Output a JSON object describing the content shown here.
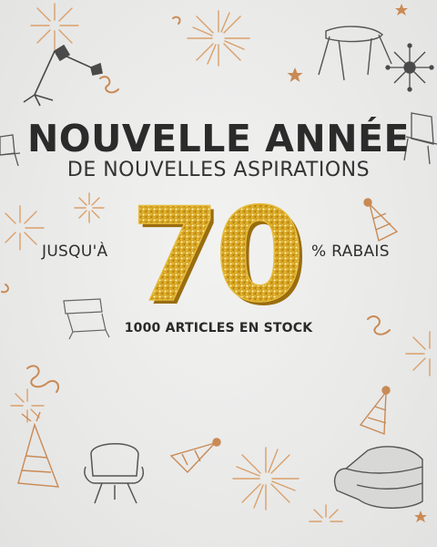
{
  "banner": {
    "headline": "NOUVELLE ANNÉE",
    "subheadline": "DE NOUVELLES ASPIRATIONS",
    "discount_prefix": "JUSQU'À",
    "discount_value": "70",
    "discount_suffix": "% RABAIS",
    "stock_note": "1000 ARTICLES EN STOCK"
  },
  "colors": {
    "text": "#2b2b2b",
    "gold": "#d9a92a",
    "firework": "#d9a06a",
    "sketch": "#4a4a4a"
  },
  "decorations": [
    "firework-icon",
    "floor-lamp-icon",
    "side-table-icon",
    "sunburst-clock-icon",
    "lounge-chair-icon",
    "party-hat-icon",
    "confetti-icon",
    "star-icon",
    "armchair-icon",
    "floor-cushion-sofa-icon"
  ]
}
